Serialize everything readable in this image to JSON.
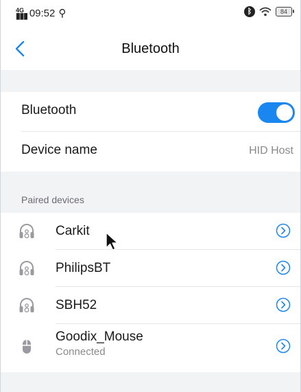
{
  "status_bar": {
    "network": "4G",
    "time": "09:52",
    "battery": "84"
  },
  "nav": {
    "title": "Bluetooth"
  },
  "settings": {
    "bluetooth_label": "Bluetooth",
    "bluetooth_enabled": true,
    "device_name_label": "Device name",
    "device_name_value": "HID Host"
  },
  "paired": {
    "header": "Paired devices",
    "devices": [
      {
        "name": "Carkit",
        "status": "",
        "icon": "headphones-icon"
      },
      {
        "name": "PhilipsBT",
        "status": "",
        "icon": "headphones-icon"
      },
      {
        "name": "SBH52",
        "status": "",
        "icon": "headphones-icon"
      },
      {
        "name": "Goodix_Mouse",
        "status": "Connected",
        "icon": "mouse-icon"
      }
    ]
  },
  "colors": {
    "accent": "#1a86f0",
    "background": "#f2f3f5",
    "secondary_text": "#8a8a8e"
  }
}
